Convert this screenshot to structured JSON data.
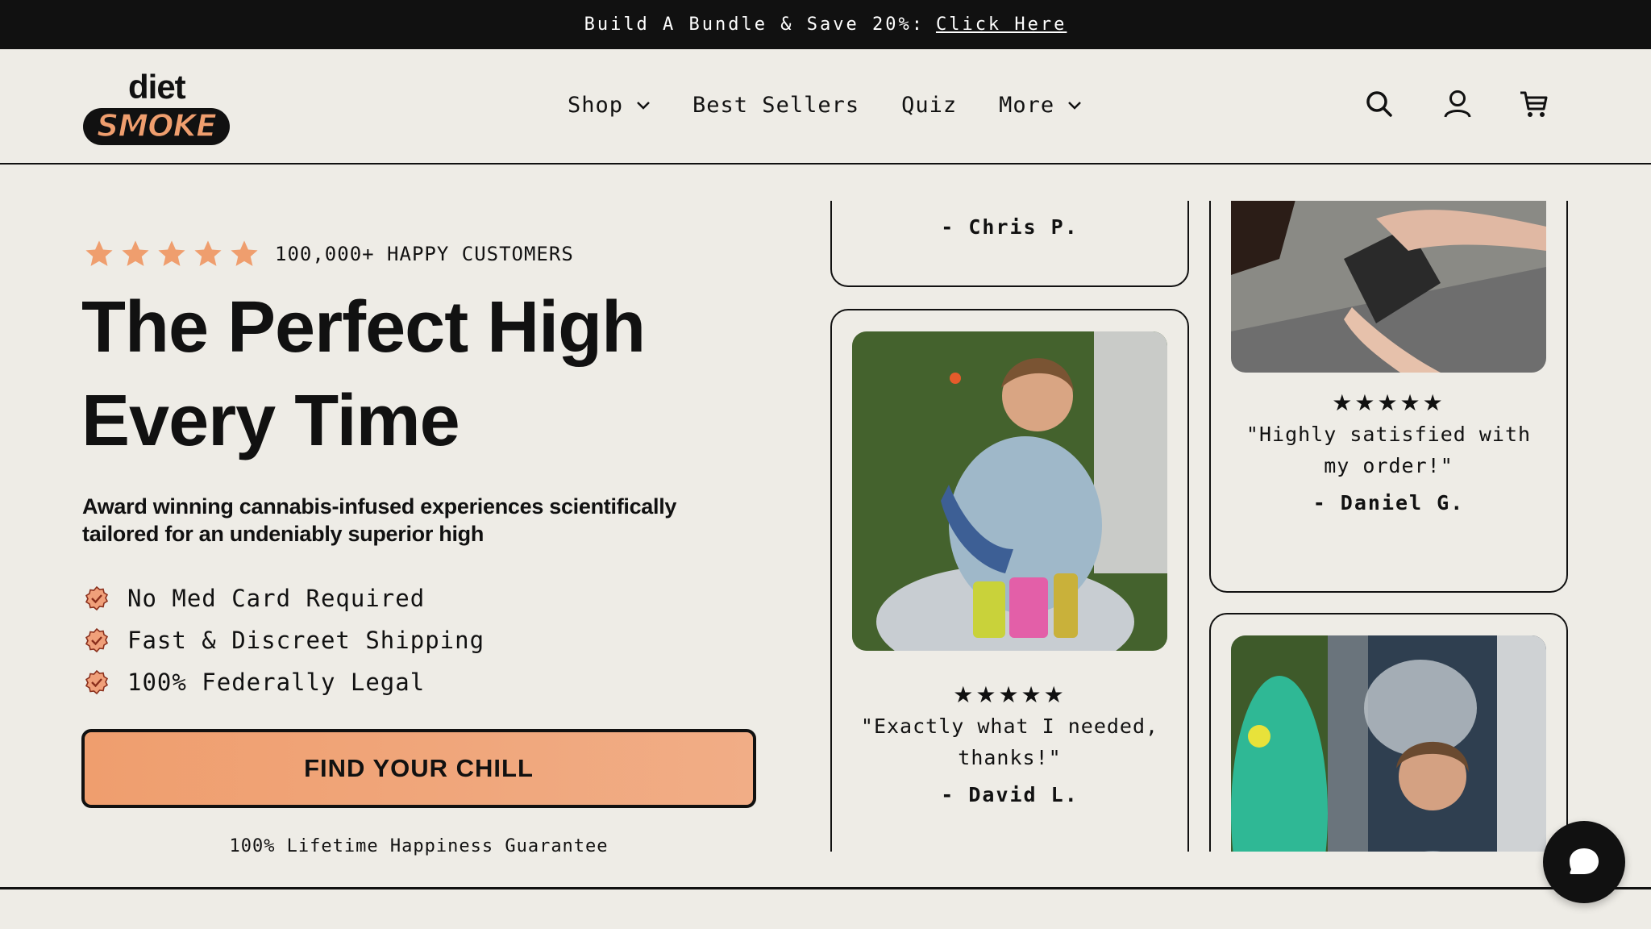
{
  "announcement": {
    "text": "Build A Bundle & Save 20%:",
    "link": "Click Here"
  },
  "logo": {
    "top": "diet",
    "bottom": "SMOKE"
  },
  "nav": {
    "items": [
      {
        "label": "Shop"
      },
      {
        "label": "Best Sellers"
      },
      {
        "label": "Quiz"
      },
      {
        "label": "More"
      }
    ]
  },
  "header_icons": [
    "search-icon",
    "account-icon",
    "cart-icon"
  ],
  "hero": {
    "rating_label": "100,000+ HAPPY CUSTOMERS",
    "title_line1": "The Perfect High",
    "title_line2": "Every Time",
    "subtitle": "Award winning cannabis-infused experiences scientifically tailored for an undeniably superior high",
    "bullets": [
      "No Med Card Required",
      "Fast & Discreet Shipping",
      "100% Federally Legal"
    ],
    "cta": "FIND YOUR CHILL",
    "guarantee": "100% Lifetime Happiness Guarantee"
  },
  "reviews": [
    {
      "author": "- Chris P."
    },
    {
      "stars": "★★★★★",
      "quote": "\"Exactly what I needed, thanks!\"",
      "author": "- David L."
    },
    {
      "stars": "★★★★★",
      "quote": "\"Highly satisfied with my order!\"",
      "author": "- Daniel G."
    }
  ],
  "colors": {
    "accent": "#ef9e6e",
    "background": "#eeece6",
    "dark": "#111111"
  }
}
